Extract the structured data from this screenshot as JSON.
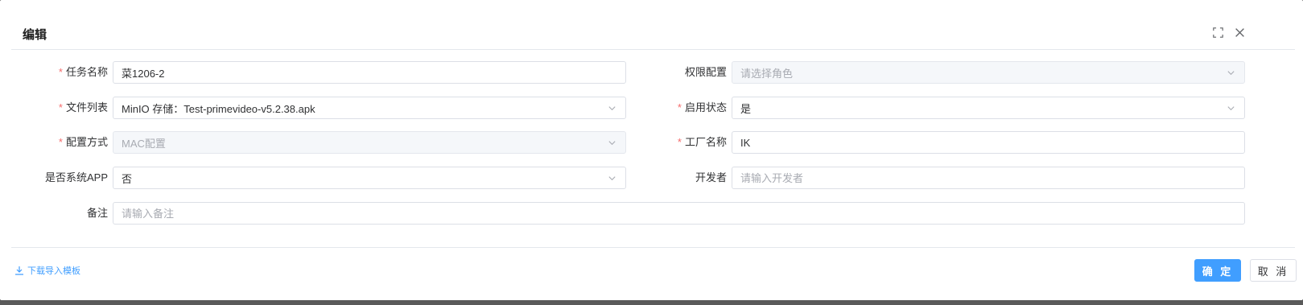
{
  "dialog": {
    "title": "编辑",
    "icons": {
      "fullscreen": "fullscreen-icon",
      "close": "close-icon"
    }
  },
  "form": {
    "task_name": {
      "label": "任务名称",
      "required": "*",
      "value": "菜1206-2"
    },
    "permission": {
      "label": "权限配置",
      "placeholder": "请选择角色"
    },
    "file_list": {
      "label": "文件列表",
      "required": "*",
      "value": "MinIO 存储：Test-primevideo-v5.2.38.apk"
    },
    "enabled": {
      "label": "启用状态",
      "required": "*",
      "value": "是"
    },
    "config_mode": {
      "label": "配置方式",
      "required": "*",
      "value": "MAC配置"
    },
    "factory_name": {
      "label": "工厂名称",
      "required": "*",
      "value": "IK"
    },
    "system_app": {
      "label": "是否系统APP",
      "value": "否"
    },
    "developer": {
      "label": "开发者",
      "placeholder": "请输入开发者"
    },
    "remark": {
      "label": "备注",
      "placeholder": "请输入备注"
    }
  },
  "footer": {
    "download_template": "下载导入模板",
    "confirm": "确 定",
    "cancel": "取 消"
  },
  "colors": {
    "primary": "#409eff",
    "required": "#f56c6c"
  }
}
